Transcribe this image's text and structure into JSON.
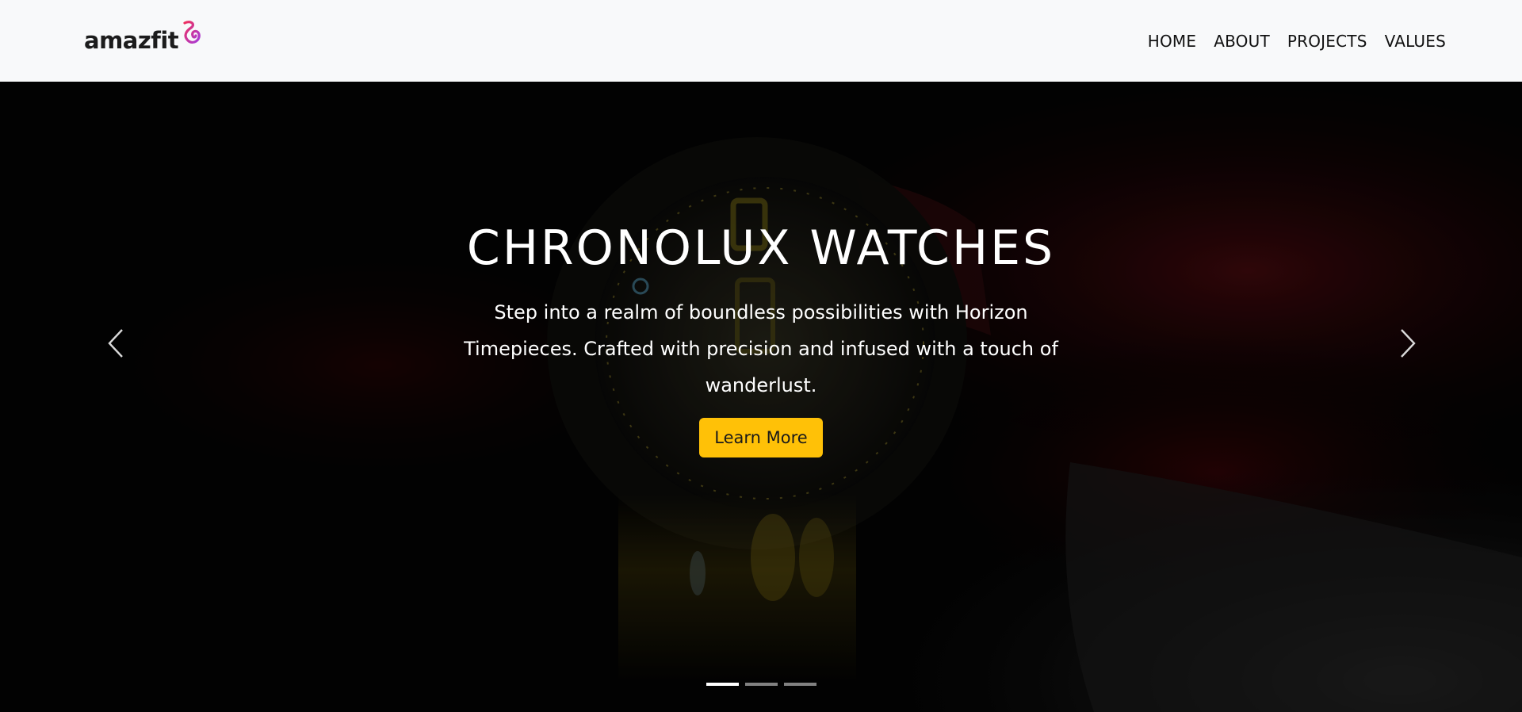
{
  "brand": {
    "name": "amazfit",
    "logo_colors": [
      "#e5366b",
      "#b83ad1"
    ]
  },
  "nav": {
    "items": [
      {
        "label": "HOME"
      },
      {
        "label": "ABOUT"
      },
      {
        "label": "PROJECTS"
      },
      {
        "label": "VALUES"
      }
    ]
  },
  "hero": {
    "title": "CHRONOLUX WATCHES",
    "description": "Step into a realm of boundless possibilities with Horizon Timepieces. Crafted with precision and infused with a touch of wanderlust.",
    "button_label": "Learn More",
    "button_color": "#ffc107",
    "background_image": "dark close-up of smartwatch face on wrist with red strap",
    "prev_icon": "chevron-left-icon",
    "next_icon": "chevron-right-icon",
    "slides_total": 3,
    "active_slide": 1
  }
}
